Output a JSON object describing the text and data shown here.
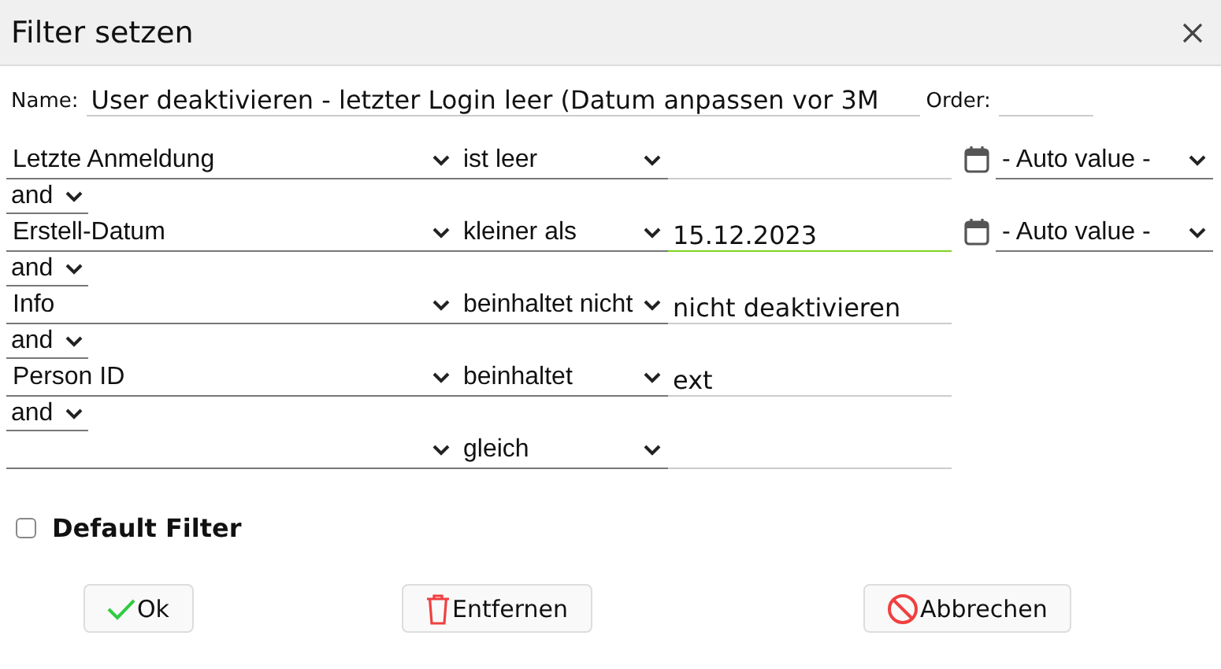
{
  "dialog": {
    "title": "Filter setzen"
  },
  "name_field": {
    "label": "Name:",
    "value": "User deaktivieren - letzter Login leer (Datum anpassen vor 3M"
  },
  "order_field": {
    "label": "Order:"
  },
  "conditions": [
    {
      "field": "Letzte Anmeldung",
      "operator": "ist leer",
      "focused": false,
      "auto_value": "- Auto value -"
    },
    {
      "connector": "and",
      "field": "Erstell-Datum",
      "operator": "kleiner als",
      "value": "15.12.2023",
      "focused": true,
      "auto_value": "- Auto value -"
    },
    {
      "connector": "and",
      "field": "Info",
      "operator": "beinhaltet nicht",
      "value": "nicht deaktivieren",
      "focused": false
    },
    {
      "connector": "and",
      "field": "Person ID",
      "operator": "beinhaltet",
      "value": "ext",
      "focused": false
    },
    {
      "connector": "and",
      "operator": "gleich",
      "focused": false
    }
  ],
  "default_filter": {
    "label": "Default Filter",
    "checked": false
  },
  "buttons": [
    {
      "kind": "ok",
      "label": "Ok"
    },
    {
      "kind": "delete",
      "label": "Entfernen"
    },
    {
      "kind": "cancel",
      "label": "Abbrechen"
    }
  ]
}
